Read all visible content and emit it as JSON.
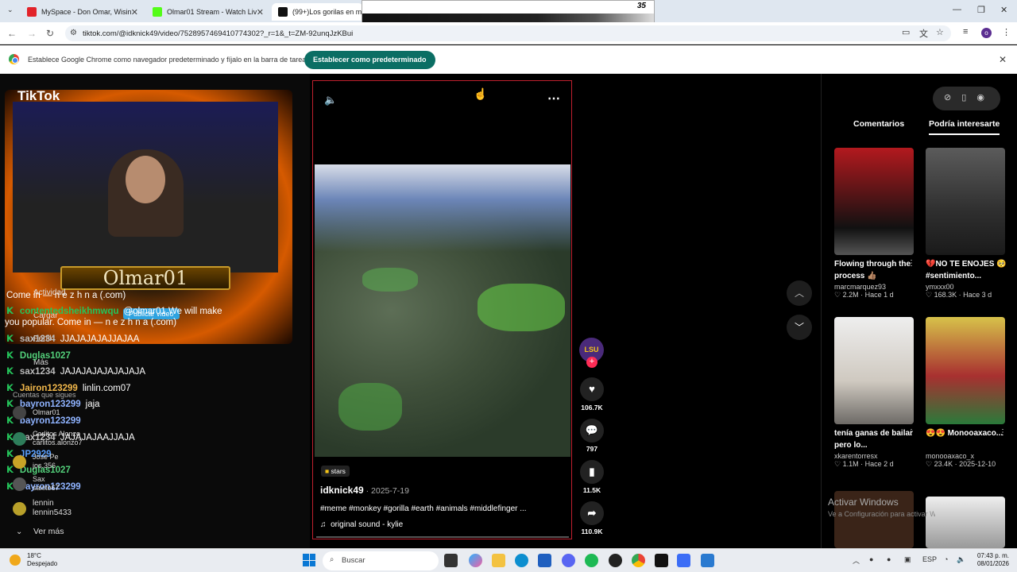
{
  "tabs": [
    {
      "title": "MySpace - Don Omar, Wisin & ...",
      "color": "#e2232a"
    },
    {
      "title": "Olmar01 Stream - Watch Live o...",
      "color": "#53fc18"
    },
    {
      "title": "(99+)Los gorilas en meme...",
      "color": "#111111"
    }
  ],
  "popup_number": "35",
  "address": {
    "url": "tiktok.com/@idknick49/video/7528957469410774302?_r=1&_t=ZM-92unqJzKBui"
  },
  "infobar": {
    "message": "Establece Google Chrome como navegador predeterminado y fíjalo en la barra de tareas",
    "button": "Establecer como predeterminado"
  },
  "stream": {
    "logo": "TikTok",
    "nameplate": "Olmar01",
    "publish_button": "Publicar video"
  },
  "sidebar_ghost": {
    "actividad": "Actividad",
    "cargar": "Cargar",
    "perfil": "Perfil",
    "mas": "Más",
    "cuentas": "Cuentas que sigues",
    "ver_mas": "Ver más"
  },
  "chat": [
    {
      "user": "",
      "msg": "Come in — n e z h n a (.com)",
      "color": "#ffffff"
    },
    {
      "user": "contentedsheikhmwqu",
      "msg": "@olmar01 We will make",
      "color": "#25c45a"
    },
    {
      "user": "",
      "msg": "you popular. Come in — n e z h n a (.com)",
      "color": "#ffffff"
    },
    {
      "user": "sax1234",
      "msg": "JJAJAJAJAJJAJAA",
      "color": "#bbbbbb"
    },
    {
      "user": "Duglas1027",
      "msg": "",
      "color": "#53d07a"
    },
    {
      "user": "sax1234",
      "msg": "JAJAJAJAJAJAJAJA",
      "color": "#bbbbbb"
    },
    {
      "user": "Jairon123299",
      "msg": "linlin.com07",
      "color": "#f2b84b"
    },
    {
      "user": "bayron123299",
      "msg": "jaja",
      "color": "#8fb3ff"
    },
    {
      "user": "bayron123299",
      "msg": "",
      "color": "#8fb3ff"
    },
    {
      "user": "sax1234",
      "msg": "JAJAJAJAAJJAJA",
      "color": "#bbbbbb"
    },
    {
      "user": "JP2929",
      "msg": "",
      "color": "#5aa0ff"
    },
    {
      "user": "Duglas1027",
      "msg": "",
      "color": "#53d07a"
    },
    {
      "user": "bayron123299",
      "msg": "",
      "color": "#8fb3ff"
    }
  ],
  "accounts": [
    {
      "name": "Olmar01",
      "handle": "olmar01"
    },
    {
      "name": "Carlitos Alonzo",
      "handle": "carlitos.alonzo7"
    },
    {
      "name": "José Pe",
      "handle": "jos.356"
    },
    {
      "name": "Sax",
      "handle": "saxito67"
    },
    {
      "name": "lennin",
      "handle": "lennin5433"
    }
  ],
  "video": {
    "badge": "stars",
    "author": "idknick49",
    "date": " · 2025-7-19",
    "tags": "#meme #monkey #gorilla #earth #animals #middlefinger ...",
    "sound": "original sound - kylie"
  },
  "actions": {
    "avatar_text": "LSU",
    "likes": "106.7K",
    "comments": "797",
    "saves": "11.5K",
    "shares": "110.9K"
  },
  "right_panel": {
    "tab_comments": "Comentarios",
    "tab_interest": "Podría interesarte",
    "cards": [
      {
        "title": "Flowing through the process 👍🏽",
        "author": "marcmarquez93",
        "stats": "2.2M · Hace 1 d",
        "thumb": "#b3191e"
      },
      {
        "title": "💔NO TE ENOJES 🥺 #sentimiento...",
        "author": "ymxxx00",
        "stats": "168.3K · Hace 3 d",
        "thumb": "#3b3b3b"
      },
      {
        "title": "tenía ganas de bailar pero lo...",
        "author": "xkarentorresx",
        "stats": "1.1M · Hace 2 d",
        "thumb": "#2a2a2a"
      },
      {
        "title": "😍😍 Monooaxaco...",
        "author": "monooaxaco_x",
        "stats": "23.4K · 2025-12-10",
        "thumb": "#a83030"
      }
    ],
    "watermark_title": "Activar Windows",
    "watermark_sub": "Ve a Configuración para activar Windows."
  },
  "taskbar": {
    "temp": "18°C",
    "weather": "Despejado",
    "search": "Buscar",
    "lang": "ESP",
    "time": "07:43 p. m.",
    "date": "08/01/2026"
  }
}
